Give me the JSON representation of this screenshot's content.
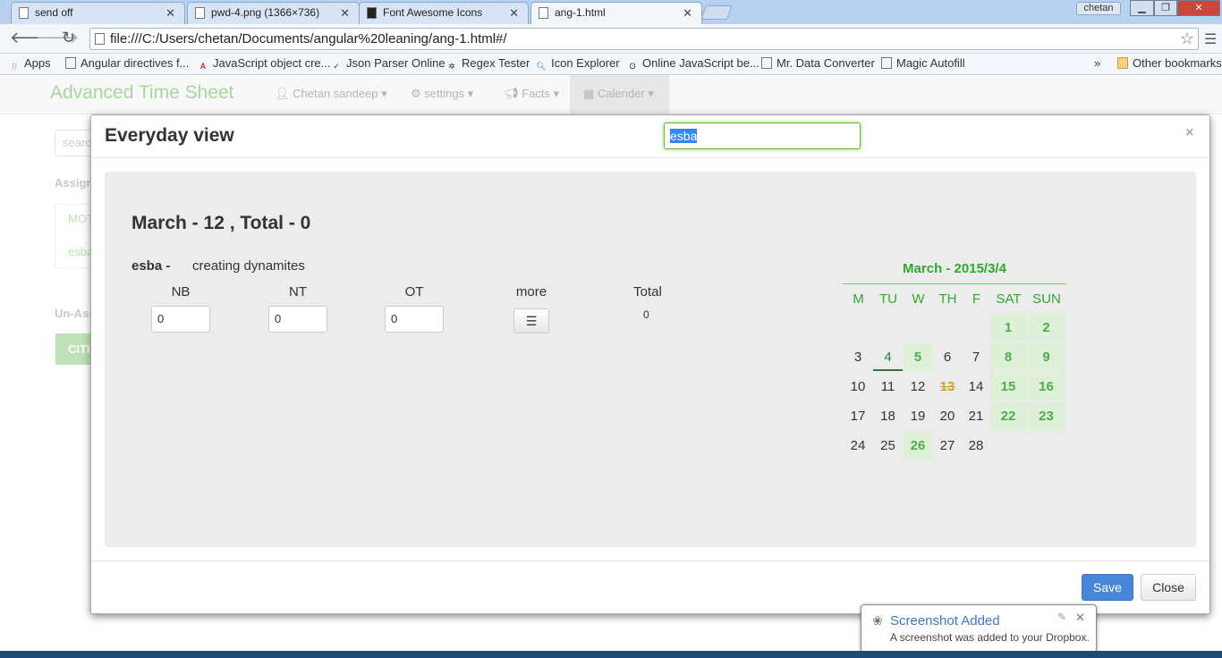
{
  "browser": {
    "tabs": [
      {
        "title": "send off"
      },
      {
        "title": "pwd-4.png (1366×736)"
      },
      {
        "title": "Font Awesome Icons"
      },
      {
        "title": "ang-1.html"
      }
    ],
    "user": "chetan",
    "url": "file:///C:/Users/chetan/Documents/angular%20leaning/ang-1.html#/",
    "bookmarks": [
      "Apps",
      "Angular directives f...",
      "JavaScript object cre...",
      "Json Parser Online",
      "Regex Tester",
      "Icon Explorer",
      "Online JavaScript be...",
      "Mr. Data Converter",
      "Magic Autofill"
    ],
    "overflow": "»",
    "other_bookmarks": "Other bookmarks"
  },
  "app": {
    "brand": "Advanced Time Sheet",
    "nav": [
      "Chetan sandeep",
      "settings",
      "Facts",
      "Calender"
    ],
    "sidebar": {
      "search_placeholder": "search",
      "assigned_label": "Assigne",
      "items": [
        "MOT",
        "esba"
      ],
      "unassigned_label": "Un-Ass",
      "button": "CITI"
    }
  },
  "modal": {
    "title": "Everyday view",
    "search_value": "esba",
    "close_symbol": "×",
    "day_heading": "March - 12 , Total - 0",
    "employee": "esba -",
    "task": "creating dynamites",
    "columns": [
      "NB",
      "NT",
      "OT",
      "more",
      "Total"
    ],
    "inputs": {
      "nb": "0",
      "nt": "0",
      "ot": "0"
    },
    "total_value": "0",
    "save_label": "Save",
    "close_label": "Close"
  },
  "calendar": {
    "title": "March - 2015/3/4",
    "day_headers": [
      "M",
      "TU",
      "W",
      "TH",
      "F",
      "SAT",
      "SUN"
    ],
    "weeks": [
      [
        "",
        "",
        "",
        "",
        "",
        "1",
        "2"
      ],
      [
        "3",
        "4",
        "5",
        "6",
        "7",
        "8",
        "9"
      ],
      [
        "10",
        "11",
        "12",
        "13",
        "14",
        "15",
        "16"
      ],
      [
        "17",
        "18",
        "19",
        "20",
        "21",
        "22",
        "23"
      ],
      [
        "24",
        "25",
        "26",
        "27",
        "28",
        "",
        ""
      ]
    ],
    "today": "4",
    "highlighted": [
      "5",
      "26"
    ],
    "struck": [
      "13"
    ]
  },
  "toast": {
    "title": "Screenshot Added",
    "message": "A screenshot was added to your Dropbox."
  }
}
